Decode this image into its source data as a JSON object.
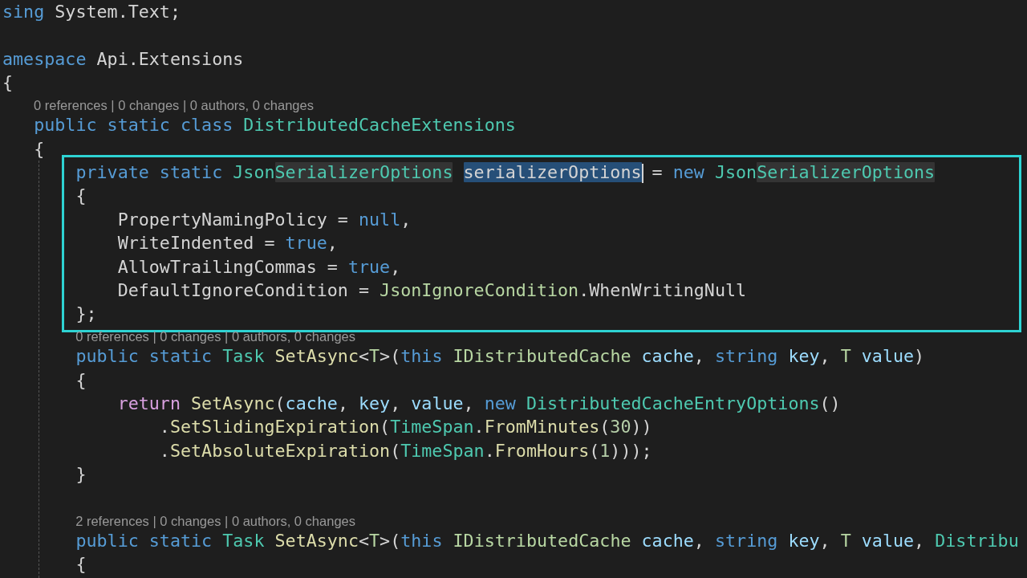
{
  "editor": {
    "blocks": [
      {
        "kind": "plain",
        "lines": [
          {
            "kind": "code",
            "tokens": [
              {
                "kind": "keyword",
                "text": "sing"
              },
              {
                "kind": "plain",
                "text": " System.Text;"
              }
            ]
          },
          {
            "kind": "blank"
          },
          {
            "kind": "code",
            "tokens": [
              {
                "kind": "keyword",
                "text": "amespace"
              },
              {
                "kind": "plain",
                "text": " Api.Extensions"
              }
            ]
          },
          {
            "kind": "code",
            "tokens": [
              {
                "kind": "plain",
                "text": "{"
              }
            ]
          },
          {
            "kind": "lens",
            "text": "0 references | 0 changes | 0 authors, 0 changes"
          },
          {
            "kind": "code",
            "tokens": [
              {
                "kind": "keyword",
                "text": "   public static class"
              },
              {
                "kind": "type",
                "text": " DistributedCacheExtensions"
              }
            ]
          },
          {
            "kind": "code",
            "tokens": [
              {
                "kind": "plain",
                "text": "   {"
              }
            ]
          }
        ]
      },
      {
        "kind": "highlight",
        "lines": [
          {
            "kind": "code",
            "tokens": [
              {
                "kind": "keyword",
                "text": "       private static"
              },
              {
                "kind": "type",
                "text": " Json"
              },
              {
                "kind": "type",
                "text": "SerializerOptions",
                "matched": true
              },
              {
                "kind": "plain",
                "text": " serializerOptions",
                "selected": true,
                "caret": true
              },
              {
                "kind": "plain",
                "text": " ="
              },
              {
                "kind": "keyword",
                "text": " new"
              },
              {
                "kind": "type",
                "text": " Json"
              },
              {
                "kind": "type",
                "text": "SerializerOptions",
                "matched": true
              }
            ]
          },
          {
            "kind": "code",
            "tokens": [
              {
                "kind": "plain",
                "text": "       {"
              }
            ]
          },
          {
            "kind": "code",
            "tokens": [
              {
                "kind": "plain",
                "text": "           PropertyNamingPolicy ="
              },
              {
                "kind": "keyword",
                "text": " null"
              },
              {
                "kind": "plain",
                "text": ","
              }
            ]
          },
          {
            "kind": "code",
            "tokens": [
              {
                "kind": "plain",
                "text": "           WriteIndented ="
              },
              {
                "kind": "keyword",
                "text": " true"
              },
              {
                "kind": "plain",
                "text": ","
              }
            ]
          },
          {
            "kind": "code",
            "tokens": [
              {
                "kind": "plain",
                "text": "           AllowTrailingCommas ="
              },
              {
                "kind": "keyword",
                "text": " true"
              },
              {
                "kind": "plain",
                "text": ","
              }
            ]
          },
          {
            "kind": "code",
            "tokens": [
              {
                "kind": "plain",
                "text": "           DefaultIgnoreCondition ="
              },
              {
                "kind": "enum",
                "text": " JsonIgnoreCondition"
              },
              {
                "kind": "plain",
                "text": ".WhenWritingNull"
              }
            ]
          },
          {
            "kind": "code",
            "tokens": [
              {
                "kind": "plain",
                "text": "       };"
              }
            ]
          }
        ]
      },
      {
        "kind": "plain",
        "lines": [
          {
            "kind": "lens",
            "text": "0 references | 0 changes | 0 authors, 0 changes"
          },
          {
            "kind": "code",
            "tokens": [
              {
                "kind": "keyword",
                "text": "       public static"
              },
              {
                "kind": "type",
                "text": " Task"
              },
              {
                "kind": "method",
                "text": " SetAsync"
              },
              {
                "kind": "plain",
                "text": "<"
              },
              {
                "kind": "typeparam",
                "text": "T"
              },
              {
                "kind": "plain",
                "text": ">("
              },
              {
                "kind": "keyword",
                "text": "this"
              },
              {
                "kind": "interface",
                "text": " IDistributedCache"
              },
              {
                "kind": "param",
                "text": " cache"
              },
              {
                "kind": "plain",
                "text": ","
              },
              {
                "kind": "keyword",
                "text": " string"
              },
              {
                "kind": "param",
                "text": " key"
              },
              {
                "kind": "plain",
                "text": ","
              },
              {
                "kind": "typeparam",
                "text": " T"
              },
              {
                "kind": "param",
                "text": " value"
              },
              {
                "kind": "plain",
                "text": ")"
              }
            ]
          },
          {
            "kind": "code",
            "tokens": [
              {
                "kind": "plain",
                "text": "       {"
              }
            ]
          },
          {
            "kind": "code",
            "tokens": [
              {
                "kind": "control",
                "text": "           return"
              },
              {
                "kind": "method",
                "text": " SetAsync"
              },
              {
                "kind": "plain",
                "text": "("
              },
              {
                "kind": "param",
                "text": "cache"
              },
              {
                "kind": "plain",
                "text": ","
              },
              {
                "kind": "param",
                "text": " key"
              },
              {
                "kind": "plain",
                "text": ","
              },
              {
                "kind": "param",
                "text": " value"
              },
              {
                "kind": "plain",
                "text": ","
              },
              {
                "kind": "keyword",
                "text": " new"
              },
              {
                "kind": "type",
                "text": " DistributedCacheEntryOptions"
              },
              {
                "kind": "plain",
                "text": "()"
              }
            ]
          },
          {
            "kind": "code",
            "tokens": [
              {
                "kind": "plain",
                "text": "               ."
              },
              {
                "kind": "method",
                "text": "SetSlidingExpiration"
              },
              {
                "kind": "plain",
                "text": "("
              },
              {
                "kind": "type",
                "text": "TimeSpan"
              },
              {
                "kind": "plain",
                "text": "."
              },
              {
                "kind": "method",
                "text": "FromMinutes"
              },
              {
                "kind": "plain",
                "text": "("
              },
              {
                "kind": "number",
                "text": "30"
              },
              {
                "kind": "plain",
                "text": "))"
              }
            ]
          },
          {
            "kind": "code",
            "tokens": [
              {
                "kind": "plain",
                "text": "               ."
              },
              {
                "kind": "method",
                "text": "SetAbsoluteExpiration"
              },
              {
                "kind": "plain",
                "text": "("
              },
              {
                "kind": "type",
                "text": "TimeSpan"
              },
              {
                "kind": "plain",
                "text": "."
              },
              {
                "kind": "method",
                "text": "FromHours"
              },
              {
                "kind": "plain",
                "text": "("
              },
              {
                "kind": "number",
                "text": "1"
              },
              {
                "kind": "plain",
                "text": ")));"
              }
            ]
          },
          {
            "kind": "code",
            "tokens": [
              {
                "kind": "plain",
                "text": "       }"
              }
            ]
          },
          {
            "kind": "blank"
          },
          {
            "kind": "lens",
            "text": "2 references | 0 changes | 0 authors, 0 changes"
          },
          {
            "kind": "code",
            "tokens": [
              {
                "kind": "keyword",
                "text": "       public static"
              },
              {
                "kind": "type",
                "text": " Task"
              },
              {
                "kind": "method",
                "text": " SetAsync"
              },
              {
                "kind": "plain",
                "text": "<"
              },
              {
                "kind": "typeparam",
                "text": "T"
              },
              {
                "kind": "plain",
                "text": ">("
              },
              {
                "kind": "keyword",
                "text": "this"
              },
              {
                "kind": "interface",
                "text": " IDistributedCache"
              },
              {
                "kind": "param",
                "text": " cache"
              },
              {
                "kind": "plain",
                "text": ","
              },
              {
                "kind": "keyword",
                "text": " string"
              },
              {
                "kind": "param",
                "text": " key"
              },
              {
                "kind": "plain",
                "text": ","
              },
              {
                "kind": "typeparam",
                "text": " T"
              },
              {
                "kind": "param",
                "text": " value"
              },
              {
                "kind": "plain",
                "text": ","
              },
              {
                "kind": "type",
                "text": " Distribu"
              }
            ]
          },
          {
            "kind": "code",
            "tokens": [
              {
                "kind": "plain",
                "text": "       {"
              }
            ]
          }
        ]
      }
    ]
  }
}
